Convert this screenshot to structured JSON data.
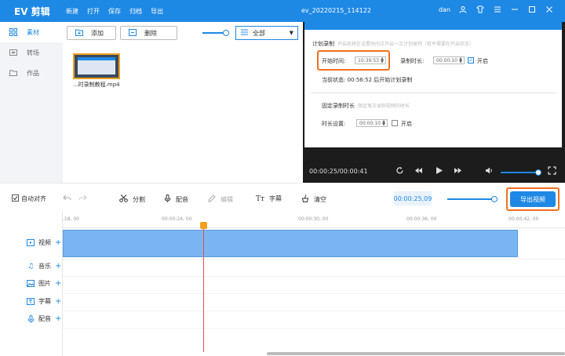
{
  "app": {
    "logo": "EV 剪辑",
    "menu": [
      "新建",
      "打开",
      "保存",
      "归档",
      "导出"
    ],
    "window_title": "ev_20220215_114122",
    "user": "dan"
  },
  "nav": [
    "素材",
    "转场",
    "作品"
  ],
  "media": {
    "add_label": "添加",
    "delete_label": "删除",
    "filter_label": "全部",
    "file_caption": "...时录制教程.mp4"
  },
  "dialog": {
    "section1": "计划录制",
    "section1_hint": "开启后将在设置时间点开启一次计划录制（软件需要在开启状态）",
    "start_label": "开始时间:",
    "start_value": "10:39:53",
    "duration_label": "录制时长:",
    "duration_value": "00:00:10",
    "open_label": "开启",
    "status_text": "当前状态: 00:56:52 后开始计划录制",
    "section2": "固定录制时长",
    "section2_hint": "限定每次录制视频的时长",
    "length_label": "时长设置:",
    "length_value": "00:00:10",
    "open_label2": "开启"
  },
  "preview": {
    "time": "00:00:25/00:00:41"
  },
  "toolbar": {
    "auto_align": "自动对齐",
    "split": "分割",
    "dub": "配音",
    "edit": "编辑",
    "subtitle": "字幕",
    "clear": "清空",
    "timecode": "00:00:25,09",
    "export": "导出视频"
  },
  "timeline": {
    "ticks": [
      ".18, 00",
      "00:00:24, 00",
      "00:00:30, 00",
      "00:00:36, 00",
      "00:00:42, 00"
    ],
    "tracks": [
      "视频",
      "音乐",
      "图片",
      "字幕",
      "配音"
    ]
  }
}
